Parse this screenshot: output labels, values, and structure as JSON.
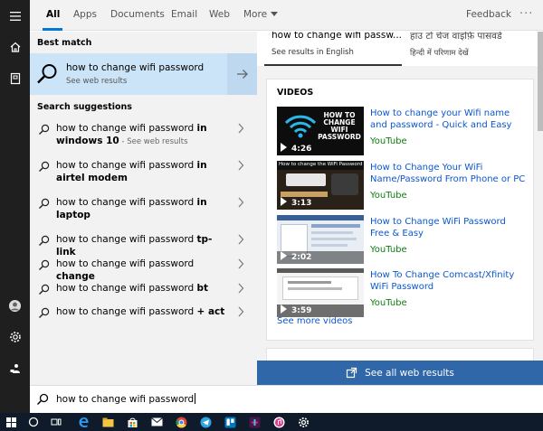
{
  "tabs": {
    "items": [
      {
        "label": "All"
      },
      {
        "label": "Apps"
      },
      {
        "label": "Documents"
      },
      {
        "label": "Email"
      },
      {
        "label": "Web"
      },
      {
        "label": "More"
      }
    ],
    "feedback": "Feedback",
    "overflow": "···"
  },
  "left": {
    "best_match_label": "Best match",
    "best_match": {
      "title": "how to change wifi password",
      "subtitle": "See web results"
    },
    "suggestions_label": "Search suggestions",
    "suggestions": [
      {
        "base": "how to change wifi password ",
        "bold": "in windows 10",
        "suffix": "See web results"
      },
      {
        "base": "how to change wifi password ",
        "bold": "in airtel modem"
      },
      {
        "base": "how to change wifi password ",
        "bold": "in laptop"
      },
      {
        "base": "how to change wifi password ",
        "bold": "tp-link"
      },
      {
        "base": "how to change wifi password ",
        "bold": "change"
      },
      {
        "base": "how to change wifi password ",
        "bold": "bt"
      },
      {
        "base": "how to change wifi password ",
        "bold": "+ act"
      }
    ]
  },
  "right": {
    "lang_a": {
      "title": "how to change wifi passw...",
      "sub": "See results in English"
    },
    "lang_b": {
      "title": "हाउ टो चेंज वाइफ़ि पासवर्ड",
      "sub": "हिन्दी में परिणाम देखें"
    },
    "videos_heading": "VIDEOS",
    "videos": [
      {
        "title": "How to change your Wifi name and password - Quick and Easy",
        "source": "YouTube",
        "duration": "4:26",
        "thumb_caption": "HOW TO CHANGE WIFI PASSWORD"
      },
      {
        "title": "How to Change Your WiFi Name/Password From Phone or PC",
        "source": "YouTube",
        "duration": "3:13",
        "thumb_caption": "How to change the WiFi Password"
      },
      {
        "title": "How to Change WiFi Password Free & Easy",
        "source": "YouTube",
        "duration": "2:02"
      },
      {
        "title": "How To Change Comcast/Xfinity WiFi Password",
        "source": "YouTube",
        "duration": "3:59"
      }
    ],
    "see_more": "See more videos",
    "see_all": "See all web results"
  },
  "search": {
    "query": "how to change wifi password"
  },
  "colors": {
    "accent": "#0078d7",
    "link": "#0b57d0",
    "source": "#0f7b0f",
    "selected": "#cce4f7",
    "button": "#2f67a8"
  }
}
